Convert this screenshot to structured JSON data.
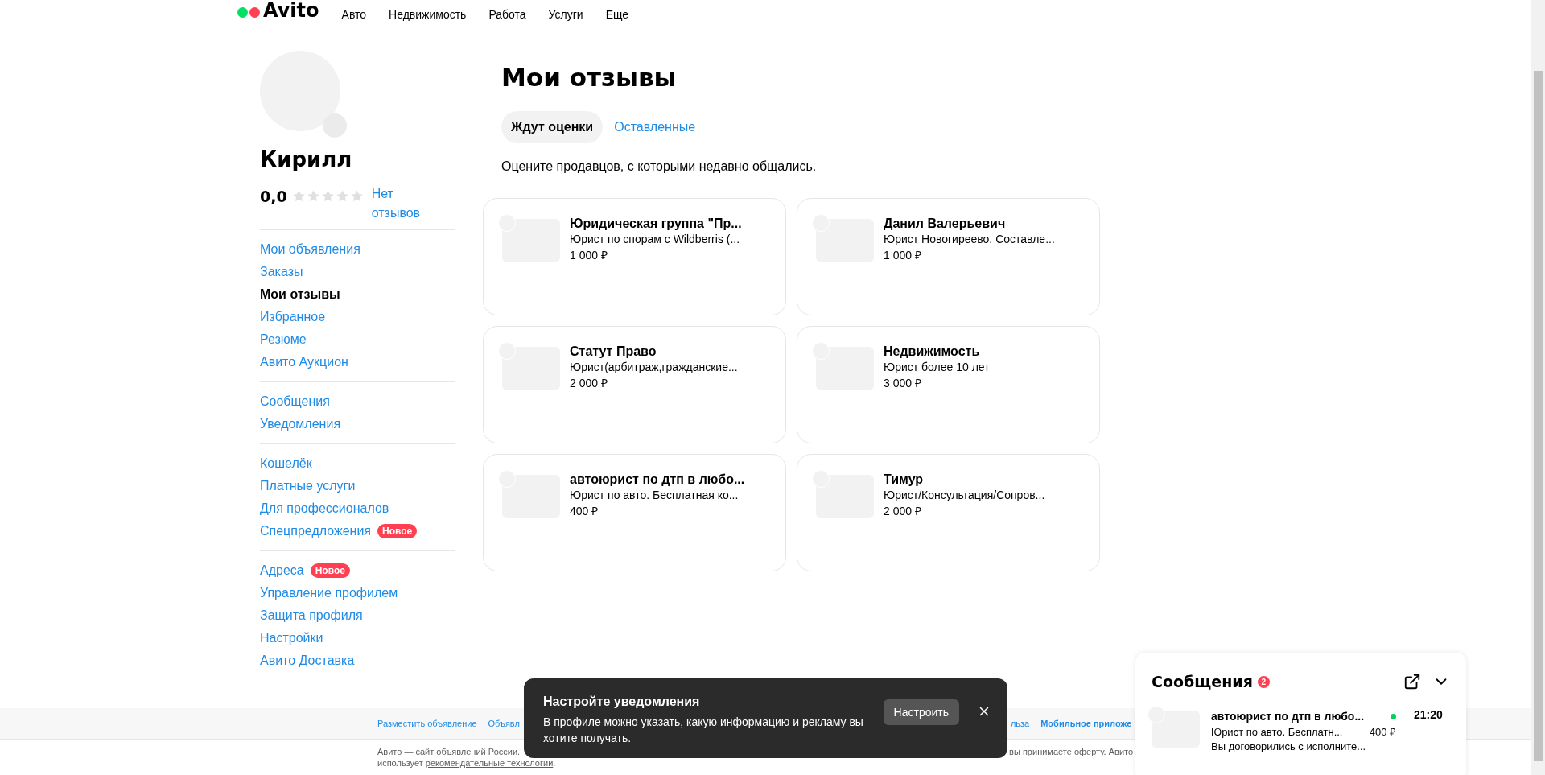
{
  "header": {
    "logo": "Avito",
    "nav": [
      "Авто",
      "Недвижимость",
      "Работа",
      "Услуги",
      "Еще"
    ]
  },
  "profile": {
    "name": "Кирилл",
    "rating": "0,0",
    "stars": 0,
    "reviews_link": "Нет отзывов"
  },
  "menu": [
    [
      {
        "label": "Мои объявления",
        "selected": false
      },
      {
        "label": "Заказы",
        "selected": false
      },
      {
        "label": "Мои отзывы",
        "selected": true
      },
      {
        "label": "Избранное",
        "selected": false
      },
      {
        "label": "Резюме",
        "selected": false
      },
      {
        "label": "Авито Аукцион",
        "selected": false
      }
    ],
    [
      {
        "label": "Сообщения",
        "selected": false
      },
      {
        "label": "Уведомления",
        "selected": false
      }
    ],
    [
      {
        "label": "Кошелёк",
        "selected": false
      },
      {
        "label": "Платные услуги",
        "selected": false
      },
      {
        "label": "Для профессионалов",
        "selected": false
      },
      {
        "label": "Спецпредложения",
        "selected": false,
        "badge": "Новое"
      }
    ],
    [
      {
        "label": "Адреса",
        "selected": false,
        "badge": "Новое"
      },
      {
        "label": "Управление профилем",
        "selected": false
      },
      {
        "label": "Защита профиля",
        "selected": false
      },
      {
        "label": "Настройки",
        "selected": false
      },
      {
        "label": "Авито Доставка",
        "selected": false
      }
    ]
  ],
  "page": {
    "title": "Мои отзывы",
    "tabs": [
      {
        "label": "Ждут оценки",
        "selected": true
      },
      {
        "label": "Оставленные",
        "selected": false
      }
    ],
    "hint": "Оцените продавцов, с которыми недавно общались.",
    "cards": [
      {
        "title": "Юридическая группа \"Пр...",
        "subtitle": "Юрист по спорам с Wildberris (...",
        "price": "1 000 ₽"
      },
      {
        "title": "Данил Валерьевич",
        "subtitle": "Юрист Новогиреево. Составле...",
        "price": "1 000 ₽"
      },
      {
        "title": "Статут Право",
        "subtitle": "Юрист(арбитраж,гражданские...",
        "price": "2 000 ₽"
      },
      {
        "title": "Недвижимость",
        "subtitle": "Юрист более 10 лет",
        "price": "3 000 ₽"
      },
      {
        "title": "автоюрист по дтп в любо...",
        "subtitle": "Юрист по авто. Бесплатная ко...",
        "price": "400 ₽"
      },
      {
        "title": "Тимур",
        "subtitle": "Юрист/Консультация/Сопров...",
        "price": "2 000 ₽"
      }
    ]
  },
  "footer": {
    "links_left": [
      {
        "label": "Разместить объявление",
        "bold": false
      },
      {
        "label": "Объявл",
        "bold": false
      }
    ],
    "links_right": [
      {
        "label": "льза",
        "bold": false
      },
      {
        "label": "Мобильное приложе",
        "bold": true
      }
    ],
    "note_left": [
      {
        "text": "Авито — ",
        "link": false
      },
      {
        "text": "сайт объявлений России",
        "link": true
      },
      {
        "text": ".",
        "link": false
      }
    ],
    "note_right": [
      {
        "text": "вы принимаете ",
        "link": false
      },
      {
        "text": "оферту",
        "link": true
      },
      {
        "text": ". Авито",
        "link": false
      }
    ],
    "note_line2": [
      {
        "text": "использует ",
        "link": false
      },
      {
        "text": "рекомендательные технологии",
        "link": true
      },
      {
        "text": ".",
        "link": false
      }
    ]
  },
  "toast": {
    "title": "Настройте уведомления",
    "text": "В профиле можно указать, какую информацию и рекламу вы хотите получать.",
    "button": "Настроить"
  },
  "messages": {
    "title": "Сообщения",
    "count": "2",
    "items": [
      {
        "title": "автоюрист по дтп в любо...",
        "subtitle": "Юрист по авто. Бесплатн...",
        "price": "400 ₽",
        "preview": "Вы договорились с исполните...",
        "time": "21:20",
        "online": true
      }
    ]
  }
}
